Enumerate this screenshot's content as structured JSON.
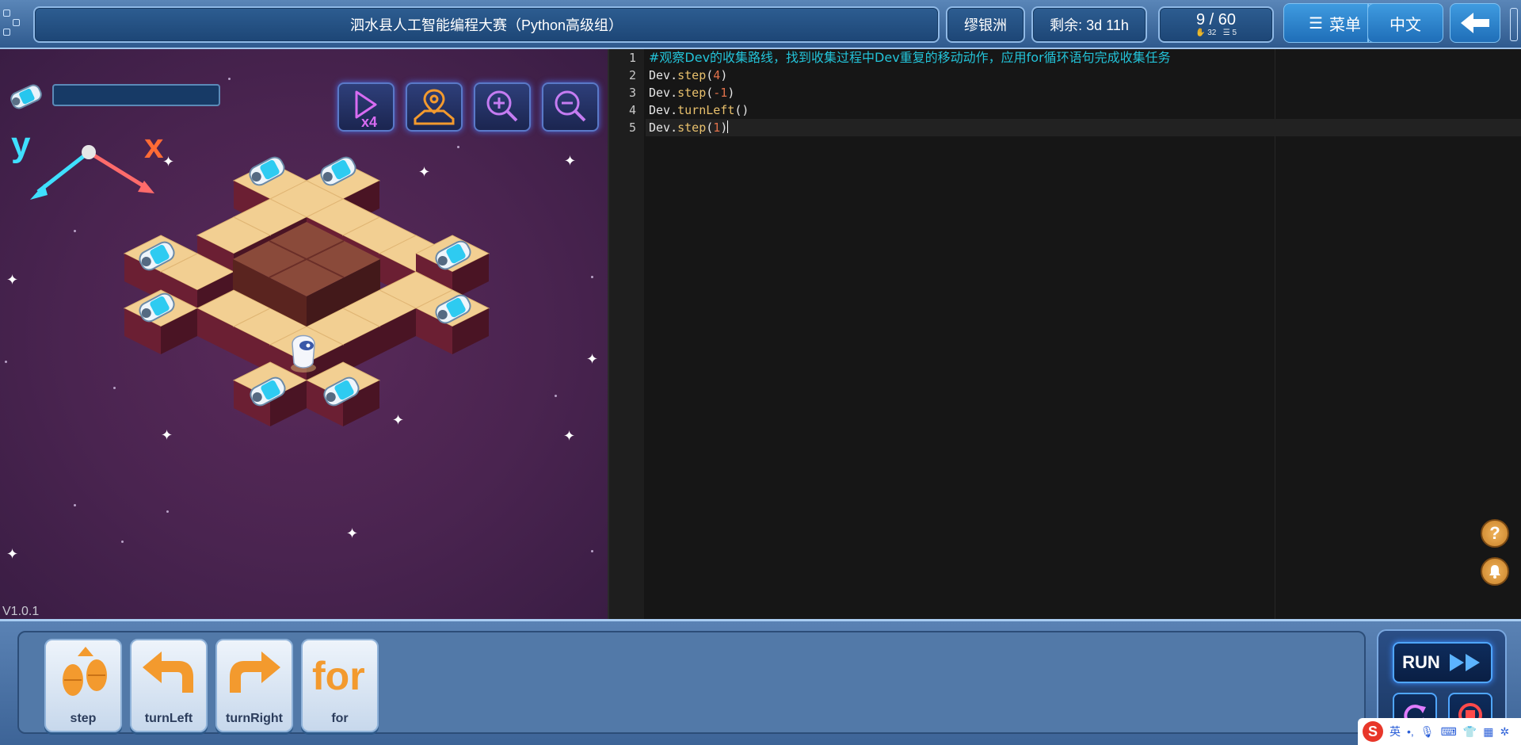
{
  "header": {
    "title": "泗水县人工智能编程大赛（Python高级组）",
    "user": "缪银洲",
    "remaining": "剩余: 3d 11h",
    "progress": {
      "main": "9 / 60",
      "sub1": "32",
      "sub2": "5"
    },
    "menu_label": "菜单",
    "language_label": "中文"
  },
  "game": {
    "axis_y_label": "y",
    "axis_x_label": "x",
    "version": "V1.0.1",
    "player_name_field": ""
  },
  "editor": {
    "line_numbers": [
      "1",
      "2",
      "3",
      "4",
      "5"
    ],
    "comment": "#观察Dev的收集路线，找到收集过程中Dev重复的移动动作，应用for循环语句完成收集任务",
    "lines": [
      {
        "obj": "Dev.",
        "fn": "step",
        "open": "(",
        "arg": "4",
        "close": ")"
      },
      {
        "obj": "Dev.",
        "fn": "step",
        "open": "(",
        "arg": "-1",
        "close": ")"
      },
      {
        "obj": "Dev.",
        "fn": "turnLeft",
        "open": "()",
        "arg": "",
        "close": ""
      },
      {
        "obj": "Dev.",
        "fn": "step",
        "open": "(",
        "arg": "1",
        "close": ")"
      }
    ]
  },
  "blocks": [
    {
      "label": "step"
    },
    {
      "label": "turnLeft"
    },
    {
      "label": "turnRight"
    },
    {
      "label": "for"
    }
  ],
  "controls": {
    "run_label": "RUN"
  },
  "ime": {
    "mode": "英"
  },
  "colors": {
    "accent": "#2f8fd8",
    "comment": "#23c3d8",
    "function": "#e8c06c",
    "number": "#e0714a"
  }
}
